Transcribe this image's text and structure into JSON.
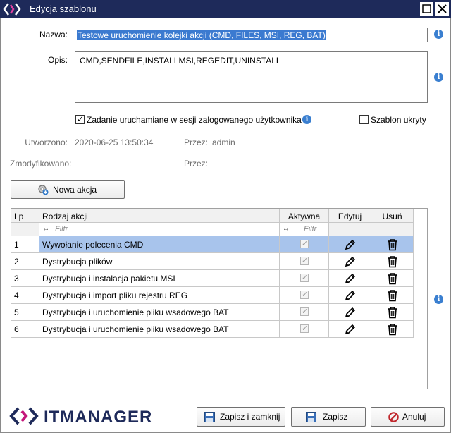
{
  "window": {
    "title": "Edycja szablonu"
  },
  "form": {
    "name_label": "Nazwa:",
    "name_value": "Testowe uruchomienie kolejki akcji (CMD, FILES, MSI, REG, BAT)",
    "desc_label": "Opis:",
    "desc_value": "CMD,SENDFILE,INSTALLMSI,REGEDIT,UNINSTALL",
    "session_checkbox_label": "Zadanie uruchamiane w sesji zalogowanego użytkownika",
    "hidden_checkbox_label": "Szablon ukryty",
    "created_label": "Utworzono:",
    "created_value": "2020-06-25 13:50:34",
    "created_by_label": "Przez:",
    "created_by_value": "admin",
    "modified_label": "Zmodyfikowano:",
    "modified_by_label": "Przez:"
  },
  "toolbar": {
    "new_action": "Nowa akcja"
  },
  "grid": {
    "columns": {
      "lp": "Lp",
      "type": "Rodzaj akcji",
      "active": "Aktywna",
      "edit": "Edytuj",
      "delete": "Usuń"
    },
    "filter_placeholder": "Filtr",
    "filter_arrows": "↔",
    "rows": [
      {
        "lp": "1",
        "type": "Wywołanie polecenia CMD"
      },
      {
        "lp": "2",
        "type": "Dystrybucja plików"
      },
      {
        "lp": "3",
        "type": "Dystrybucja i instalacja pakietu MSI"
      },
      {
        "lp": "4",
        "type": "Dystrybucja i import pliku rejestru REG"
      },
      {
        "lp": "5",
        "type": "Dystrybucja i uruchomienie pliku wsadowego BAT"
      },
      {
        "lp": "6",
        "type": "Dystrybucja i uruchomienie pliku wsadowego BAT"
      }
    ]
  },
  "footer": {
    "brand": "ITMANAGER",
    "save_close": "Zapisz i zamknij",
    "save": "Zapisz",
    "cancel": "Anuluj"
  },
  "info_glyph": "i",
  "check_glyph": "✓",
  "colors": {
    "titlebar": "#1e2a5a",
    "selection": "#a8c4ec",
    "info": "#3a7fd0",
    "cancel": "#c0282d",
    "brand_magenta": "#c4167a"
  }
}
